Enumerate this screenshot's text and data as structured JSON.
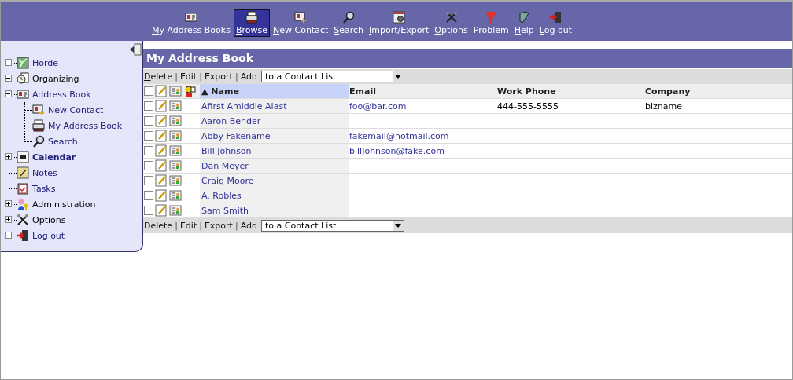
{
  "toolbar": [
    {
      "label": "My Address Books",
      "underline_first": true,
      "selected": false
    },
    {
      "label": "Browse",
      "underline_first": true,
      "selected": true
    },
    {
      "label": "New Contact",
      "underline_first": true,
      "selected": false
    },
    {
      "label": "Search",
      "underline_first": true,
      "selected": false
    },
    {
      "label": "Import/Export",
      "underline_first": true,
      "selected": false
    },
    {
      "label": "Options",
      "underline_first": true,
      "selected": false
    },
    {
      "label": "Problem",
      "underline_first": false,
      "selected": false
    },
    {
      "label": "Help",
      "underline_first": true,
      "selected": false
    },
    {
      "label": "Log out",
      "underline_first": true,
      "selected": false
    }
  ],
  "sidebar": {
    "tree": [
      {
        "label": "Horde",
        "kind": "leaf",
        "link": true,
        "current": false
      },
      {
        "label": "Organizing",
        "kind": "branch",
        "expanded": true,
        "link": false,
        "current": false,
        "children": [
          {
            "label": "Address Book",
            "kind": "branch",
            "expanded": true,
            "link": true,
            "current": false,
            "children": [
              {
                "label": "New Contact",
                "kind": "child",
                "link": true,
                "current": false
              },
              {
                "label": "My Address Book",
                "kind": "child",
                "link": true,
                "current": false
              },
              {
                "label": "Search",
                "kind": "child",
                "link": true,
                "current": false
              }
            ]
          },
          {
            "label": "Calendar",
            "kind": "branch",
            "expanded": false,
            "link": true,
            "current": true
          },
          {
            "label": "Notes",
            "kind": "child",
            "link": true,
            "current": false
          },
          {
            "label": "Tasks",
            "kind": "child",
            "link": true,
            "current": false
          }
        ]
      },
      {
        "label": "Administration",
        "kind": "branch",
        "expanded": false,
        "link": false,
        "current": false
      },
      {
        "label": "Options",
        "kind": "branch",
        "expanded": false,
        "link": false,
        "current": false
      },
      {
        "label": "Log out",
        "kind": "leaf",
        "link": true,
        "current": false
      }
    ]
  },
  "main": {
    "title": "My Address Book",
    "actions_top": {
      "items": [
        {
          "kind": "link",
          "label": "Delete",
          "underline_first": true
        },
        {
          "kind": "separator",
          "label": "|"
        },
        {
          "kind": "link",
          "label": "Edit",
          "underline_first": false
        },
        {
          "kind": "separator",
          "label": "|"
        },
        {
          "kind": "link",
          "label": "Export",
          "underline_first": false
        },
        {
          "kind": "separator",
          "label": "|"
        },
        {
          "kind": "link",
          "label": "Add",
          "underline_first": false
        }
      ],
      "select": "to a Contact List"
    },
    "table": {
      "select_all_checked": false,
      "columns": [
        {
          "label": "Name",
          "sorted": true,
          "sort_arrow": "▲"
        },
        {
          "label": "Email",
          "sorted": false
        },
        {
          "label": "Work Phone",
          "sorted": false
        },
        {
          "label": "Company",
          "sorted": false
        }
      ],
      "rows": [
        {
          "checked": false,
          "name": "Afirst Amiddle Alast",
          "email": "foo@bar.com",
          "work_phone": "444-555-5555",
          "company": "bizname"
        },
        {
          "checked": false,
          "name": "Aaron Bender"
        },
        {
          "checked": false,
          "name": "Abby Fakename",
          "email": "fakemail@hotmail.com"
        },
        {
          "checked": false,
          "name": "Bill Johnson",
          "email": "billJohnson@fake.com"
        },
        {
          "checked": false,
          "name": "Dan Meyer"
        },
        {
          "checked": false,
          "name": "Craig Moore"
        },
        {
          "checked": false,
          "name": "A. Robles"
        },
        {
          "checked": false,
          "name": "Sam Smith"
        }
      ]
    },
    "actions_bottom": {
      "items": [
        {
          "kind": "link",
          "label": "Delete",
          "underline_first": false
        },
        {
          "kind": "separator",
          "label": "|"
        },
        {
          "kind": "link",
          "label": "Edit",
          "underline_first": false
        },
        {
          "kind": "separator",
          "label": "|"
        },
        {
          "kind": "link",
          "label": "Export",
          "underline_first": false
        },
        {
          "kind": "separator",
          "label": "|"
        },
        {
          "kind": "link",
          "label": "Add",
          "underline_first": false
        }
      ],
      "select": "to a Contact List"
    }
  }
}
